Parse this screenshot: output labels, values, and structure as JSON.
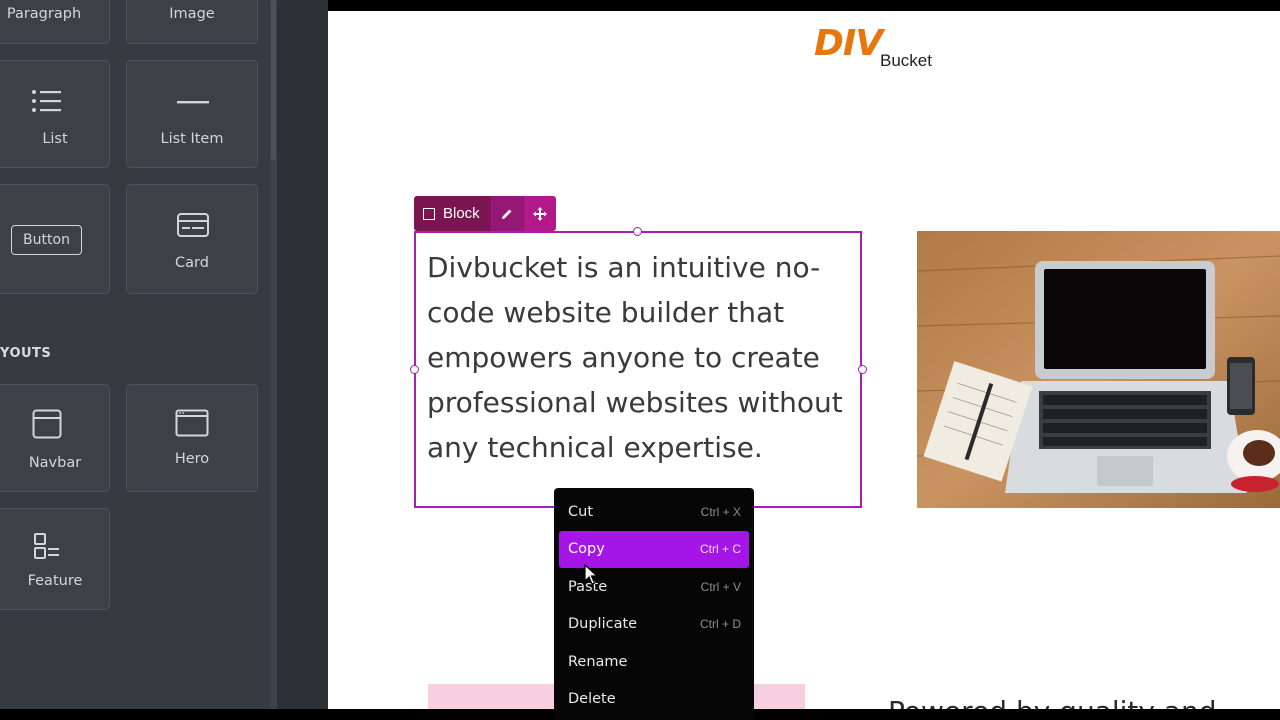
{
  "sidebar": {
    "tiles": [
      {
        "label": "Paragraph",
        "icon": "paragraph-icon"
      },
      {
        "label": "Image",
        "icon": "image-icon"
      },
      {
        "label": "List",
        "icon": "list-icon"
      },
      {
        "label": "List Item",
        "icon": "list-item-icon"
      },
      {
        "label": "Button",
        "icon": "button-icon"
      },
      {
        "label": "Card",
        "icon": "card-icon"
      },
      {
        "label": "Navbar",
        "icon": "navbar-icon"
      },
      {
        "label": "Hero",
        "icon": "hero-icon"
      },
      {
        "label": "Feature",
        "icon": "feature-icon"
      }
    ],
    "section_label": "YOUTS"
  },
  "canvas": {
    "logo": {
      "div": "DIV",
      "bucket": "Bucket",
      "color": "#e8760f"
    },
    "block_toolbar": {
      "label": "Block",
      "edit_icon": "pencil-icon",
      "move_icon": "move-icon",
      "accent": "#b3198a"
    },
    "paragraph": "Divbucket is an intuitive no-code website builder that empowers anyone to create professional websites without any technical expertise.",
    "image_alt": "laptop-on-wooden-desk-photo",
    "bottom_text": "Powered by quality and"
  },
  "context_menu": {
    "items": [
      {
        "label": "Cut",
        "shortcut": "Ctrl + X"
      },
      {
        "label": "Copy",
        "shortcut": "Ctrl + C",
        "active": true
      },
      {
        "label": "Paste",
        "shortcut": "Ctrl + V"
      },
      {
        "label": "Duplicate",
        "shortcut": "Ctrl + D"
      },
      {
        "label": "Rename",
        "shortcut": ""
      },
      {
        "label": "Delete",
        "shortcut": ""
      }
    ],
    "highlight_color": "#a515e8"
  }
}
